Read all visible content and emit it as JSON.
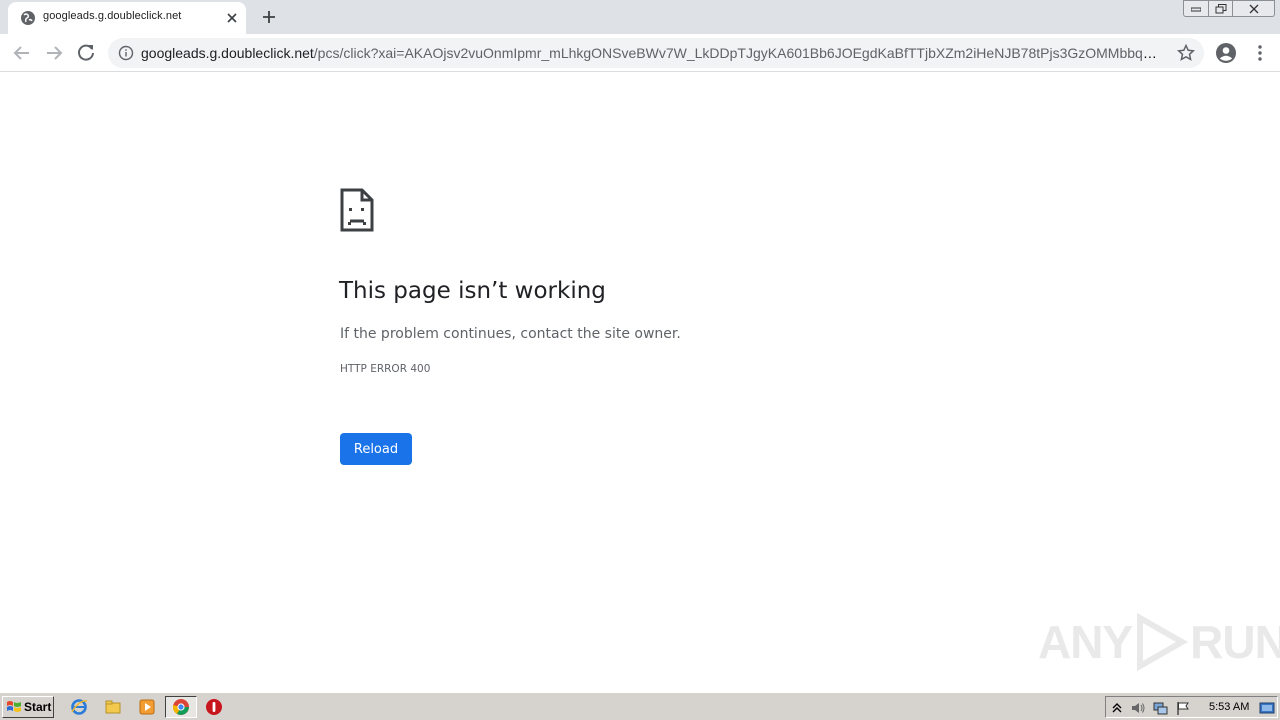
{
  "tab": {
    "title": "googleads.g.doubleclick.net",
    "favicon": "globe-icon",
    "close": "close-icon"
  },
  "toolbar": {
    "back": "arrow-left-icon",
    "forward": "arrow-right-icon",
    "reload": "reload-icon",
    "url_host": "googleads.g.doubleclick.net",
    "url_path": "/pcs/click?xai=AKAOjsv2vuOnmIpmr_mLhkgONSveBWv7W_LkDDpTJgyKA601Bb6JOEgdKaBfTTjbXZm2iHeNJB78tPjs3GzOMMbbqU_K4...",
    "bookmark": "star-icon",
    "profile": "account-icon",
    "menu": "kebab-menu-icon"
  },
  "error": {
    "icon": "sad-document-icon",
    "heading": "This page isn’t working",
    "message": "If the problem continues, contact the site owner.",
    "code": "HTTP ERROR 400",
    "reload_label": "Reload"
  },
  "watermark": {
    "text_left": "ANY",
    "text_right": "RUN"
  },
  "taskbar": {
    "start_label": "Start",
    "clock": "5:53 AM",
    "apps": [
      "ie-icon",
      "folder-icon",
      "media-player-icon",
      "chrome-icon",
      "stop-icon"
    ]
  },
  "colors": {
    "accent": "#1a73e8",
    "tabstrip": "#dee1e6",
    "taskbar": "#d6d3ce"
  }
}
